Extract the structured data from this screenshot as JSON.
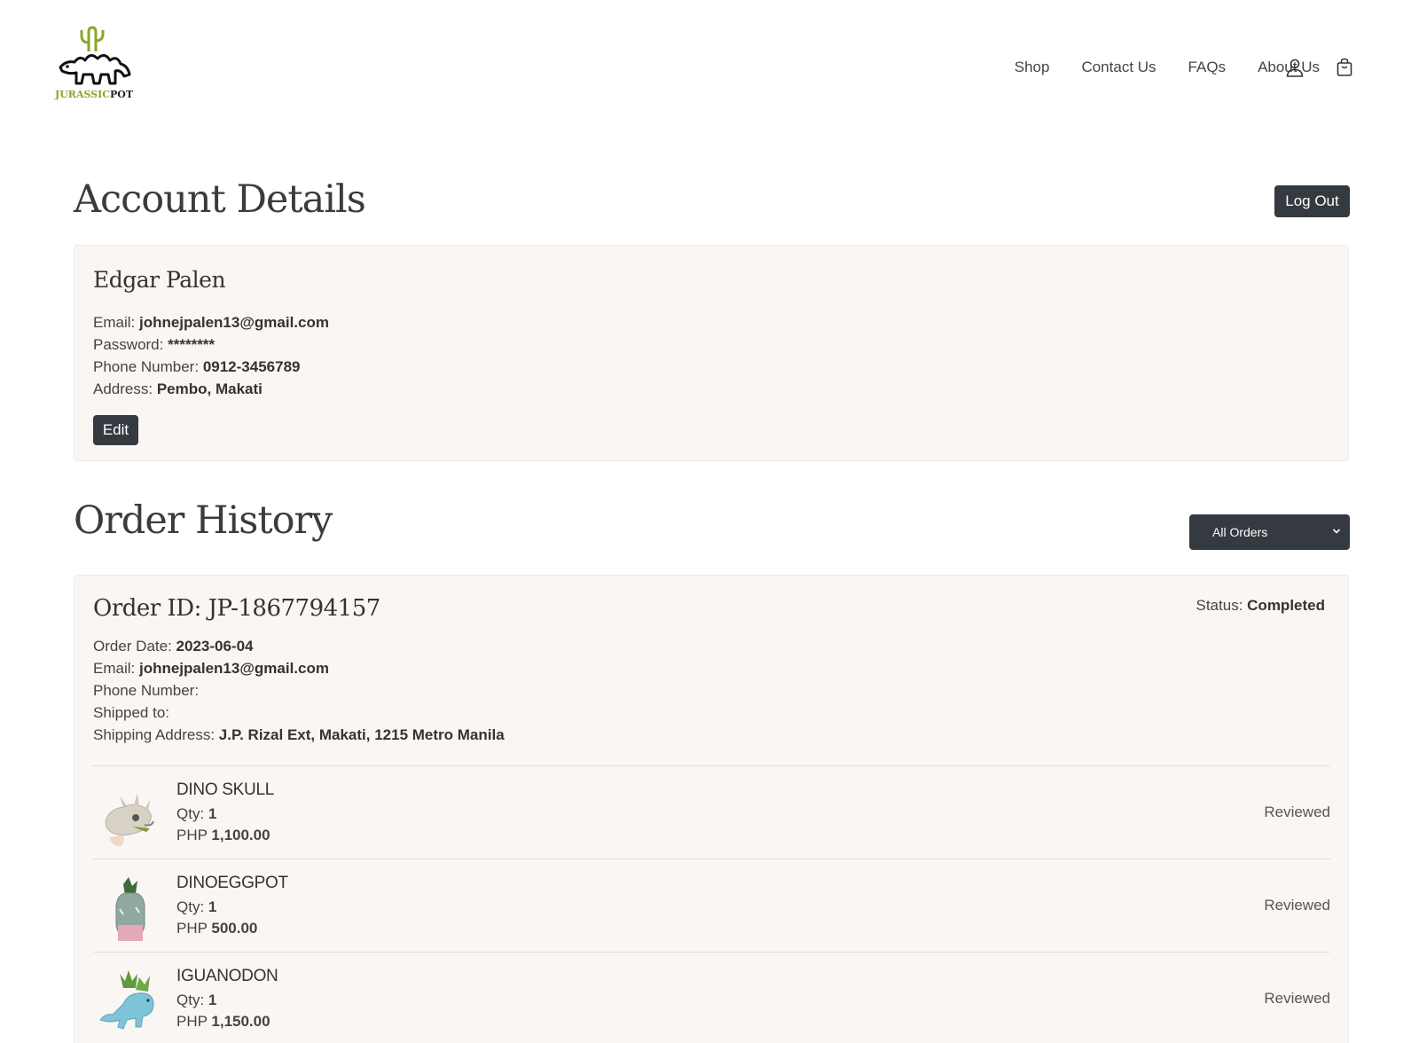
{
  "brand": {
    "name_part1": "JURASSIC",
    "name_part2": "POT",
    "green": "#8aa52a"
  },
  "nav": {
    "items": [
      "Shop",
      "Contact Us",
      "FAQs",
      "About Us"
    ],
    "icons": [
      "user-icon",
      "shopping-bag-icon"
    ]
  },
  "account": {
    "heading": "Account Details",
    "logout_label": "Log Out",
    "name": "Edgar Palen",
    "email_label": "Email:",
    "email": "johnejpalen13@gmail.com",
    "password_label": "Password:",
    "password": "********",
    "phone_label": "Phone Number:",
    "phone": "0912-3456789",
    "address_label": "Address:",
    "address": "Pembo, Makati",
    "edit_label": "Edit"
  },
  "orders": {
    "heading": "Order History",
    "filter_selected": "All Orders",
    "list": [
      {
        "title": "Order ID: JP-1867794157",
        "status_label": "Status:",
        "status": "Completed",
        "date_label": "Order Date:",
        "date": "2023-06-04",
        "email_label": "Email:",
        "email": "johnejpalen13@gmail.com",
        "phone_label": "Phone Number:",
        "phone": "",
        "shipped_label": "Shipped to:",
        "shipped": "",
        "address_label": "Shipping Address:",
        "address": "J.P. Rizal Ext, Makati, 1215 Metro Manila",
        "items": [
          {
            "name": "DINO SKULL",
            "qty_label": "Qty:",
            "qty": "1",
            "currency": "PHP",
            "price": "1,100.00",
            "review": "Reviewed"
          },
          {
            "name": "DINOEGGPOT",
            "qty_label": "Qty:",
            "qty": "1",
            "currency": "PHP",
            "price": "500.00",
            "review": "Reviewed"
          },
          {
            "name": "IGUANODON",
            "qty_label": "Qty:",
            "qty": "1",
            "currency": "PHP",
            "price": "1,150.00",
            "review": "Reviewed"
          }
        ]
      }
    ]
  }
}
